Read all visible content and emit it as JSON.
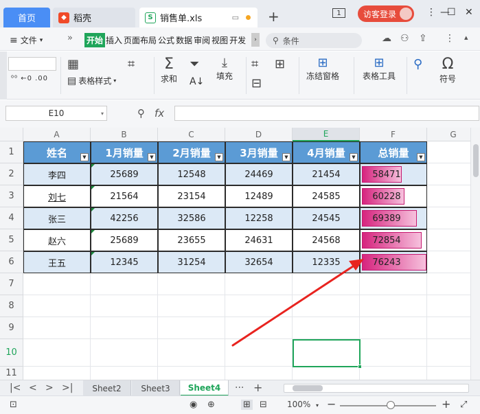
{
  "tabs": {
    "home": "首页",
    "daoke": "稻壳",
    "file": "销售单.xls"
  },
  "window": {
    "badge": "1",
    "visitor_login": "访客登录",
    "new_tab": "+"
  },
  "menu": {
    "file_label": "文件",
    "tabs": [
      "开始",
      "插入",
      "页面布局",
      "公式",
      "数据",
      "审阅",
      "视图",
      "开发"
    ],
    "active_tab": "开始",
    "search_placeholder": "条件"
  },
  "ribbon": {
    "table_style": "表格样式",
    "sum": "求和",
    "fill": "填充",
    "freeze": "冻结窗格",
    "table_tools": "表格工具",
    "symbol": "符号"
  },
  "formula_bar": {
    "name_box": "E10",
    "fx": "fx"
  },
  "grid": {
    "columns": [
      "A",
      "B",
      "C",
      "D",
      "E",
      "F",
      "G"
    ],
    "rows": [
      "1",
      "2",
      "3",
      "4",
      "5",
      "6",
      "7",
      "8",
      "9",
      "10",
      "11"
    ],
    "selected_col": "E",
    "selected_row": "10",
    "headers": [
      "姓名",
      "1月销量",
      "2月销量",
      "3月销量",
      "4月销量",
      "总销量"
    ],
    "data": [
      [
        "李四",
        "25689",
        "12548",
        "24469",
        "21454",
        "58471"
      ],
      [
        "刘七",
        "21564",
        "23154",
        "12489",
        "24585",
        "60228"
      ],
      [
        "张三",
        "42256",
        "32586",
        "12258",
        "24545",
        "69389"
      ],
      [
        "赵六",
        "25689",
        "23655",
        "24631",
        "24568",
        "72854"
      ],
      [
        "王五",
        "12345",
        "31254",
        "32654",
        "12335",
        "76243"
      ]
    ]
  },
  "sheets": {
    "tabs": [
      "Sheet2",
      "Sheet3",
      "Sheet4"
    ],
    "active": "Sheet4",
    "more": "···",
    "add": "+"
  },
  "status": {
    "zoom": "100%",
    "zoom_out": "−",
    "zoom_in": "+"
  },
  "colors": {
    "accent": "#1fa55a",
    "header_fill": "#5b9bd5",
    "band_fill": "#dce9f6",
    "databar": "#d6247e",
    "arrow": "#e8231f"
  }
}
